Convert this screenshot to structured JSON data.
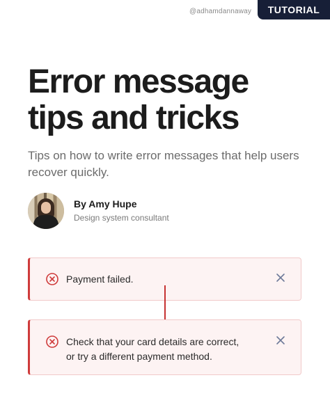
{
  "header": {
    "handle": "@adhamdannaway",
    "tag": "TUTORIAL"
  },
  "article": {
    "title_lines": [
      "Error message",
      "tips and tricks"
    ],
    "subtitle": "Tips on how to write error messages that help users recover quickly.",
    "author": {
      "name": "By Amy Hupe",
      "role": "Design system consultant"
    }
  },
  "alerts": [
    {
      "lines": [
        "Payment failed."
      ],
      "icon": "error-circle-icon",
      "close_icon": "close-icon"
    },
    {
      "lines": [
        "Check that your card details are correct,",
        "or try a different payment method."
      ],
      "icon": "error-circle-icon",
      "close_icon": "close-icon"
    }
  ],
  "colors": {
    "tag_bg": "#171f37",
    "alert_accent": "#cf3b3b",
    "alert_bg": "#fdf3f3",
    "close_icon": "#6e7a99",
    "arrow": "#c63232"
  }
}
